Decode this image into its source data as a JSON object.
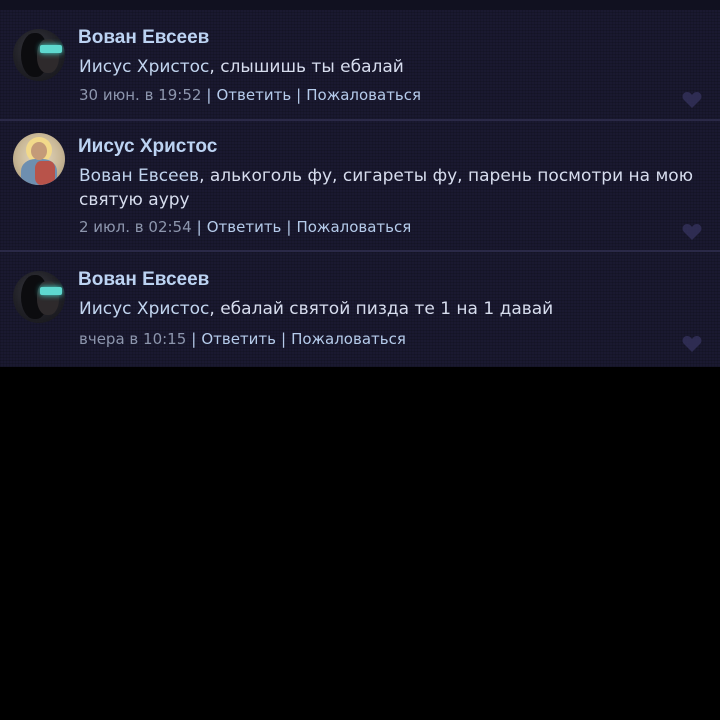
{
  "colors": {
    "panel_background": "#1a1930",
    "page_background": "#000000",
    "author": "#bcd3f2",
    "text": "#d7ddee",
    "link": "#b5cbea",
    "timestamp": "#8d96ad",
    "heart": "#2e2c52"
  },
  "comments": [
    {
      "author": "Вован Евсеев",
      "avatar_icon": "user-avatar-dark",
      "mention": "Иисус Христос",
      "body": ", слышишь ты ебалай",
      "timestamp": "30 июн. в 19:52",
      "reply_label": "Ответить",
      "separator": "|",
      "report_label": "Пожаловаться",
      "like_icon": "heart-icon"
    },
    {
      "author": "Иисус Христос",
      "avatar_icon": "user-avatar-icon-image",
      "mention": "Вован Евсеев",
      "body": ", алькоголь фу, сигареты фу, парень посмотри на мою святую ауру",
      "timestamp": "2 июл. в 02:54",
      "reply_label": "Ответить",
      "separator": "|",
      "report_label": "Пожаловаться",
      "like_icon": "heart-icon"
    },
    {
      "author": "Вован Евсеев",
      "avatar_icon": "user-avatar-dark",
      "mention": "Иисус Христос",
      "body": ", ебалай святой пизда те 1 на 1 давай",
      "timestamp": "вчера в 10:15",
      "reply_label": "Ответить",
      "separator": "|",
      "report_label": "Пожаловаться",
      "like_icon": "heart-icon"
    }
  ]
}
